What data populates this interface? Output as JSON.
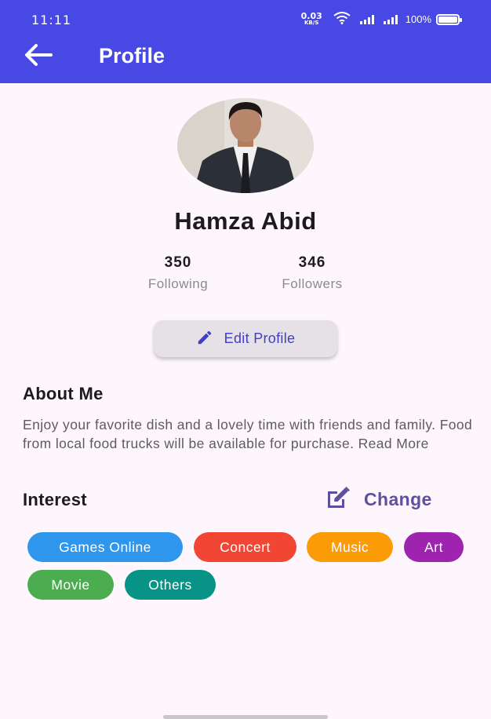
{
  "status_bar": {
    "time": "11:11",
    "net_speed_value": "0.03",
    "net_speed_unit": "KB/S",
    "battery": "100%"
  },
  "appbar": {
    "title": "Profile",
    "back_icon": "arrow-back-icon",
    "color": "#4848e4"
  },
  "profile": {
    "name": "Hamza Abid",
    "stats": [
      {
        "value": "350",
        "label": "Following"
      },
      {
        "value": "346",
        "label": "Followers"
      }
    ],
    "edit_button_label": "Edit Profile"
  },
  "about": {
    "title": "About Me",
    "text": "Enjoy your favorite dish and a lovely time with friends and family. Food from local food trucks will be available for purchase. Read More"
  },
  "interest": {
    "title": "Interest",
    "change_label": "Change",
    "chips": [
      {
        "label": "Games Online",
        "color": "#2f96ee"
      },
      {
        "label": "Concert",
        "color": "#f24634"
      },
      {
        "label": "Music",
        "color": "#fb9b06"
      },
      {
        "label": "Art",
        "color": "#9e24b0"
      },
      {
        "label": "Movie",
        "color": "#4bad4f"
      },
      {
        "label": "Others",
        "color": "#079487"
      }
    ]
  },
  "colors": {
    "accent": "#3f3fc9",
    "change": "#5e4fa0",
    "background": "#fdf7fd"
  }
}
